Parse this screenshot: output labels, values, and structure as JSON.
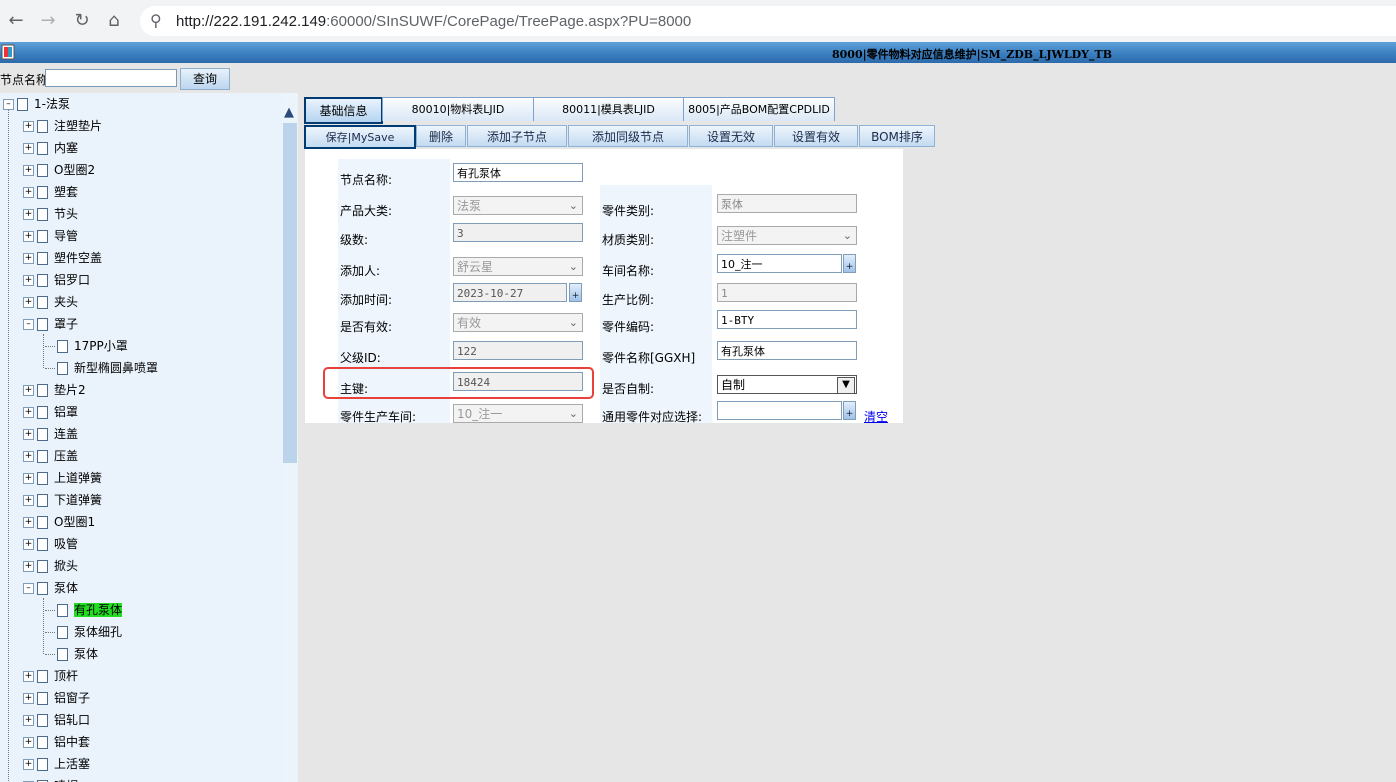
{
  "browser": {
    "url_host": "http://222.191.242.149",
    "url_rest": ":60000/SInSUWF/CorePage/TreePage.aspx?PU=8000"
  },
  "title_bar": {
    "title": "8000|零件物料对应信息维护|SM_ZDB_LJWLDY_TB"
  },
  "search": {
    "label": "节点名称",
    "value": "",
    "button": "查询"
  },
  "tree": {
    "root": "1-法泵",
    "items": [
      "注塑垫片",
      "内塞",
      "O型圈2",
      "塑套",
      "节头",
      "导管",
      "塑件空盖",
      "铝罗口",
      "夹头",
      "罩子",
      "17PP小罩",
      "新型椭圆鼻喷罩",
      "垫片2",
      "铝罩",
      "连盖",
      "压盖",
      "上道弹簧",
      "下道弹簧",
      "O型圈1",
      "吸管",
      "掀头",
      "泵体",
      "有孔泵体",
      "泵体细孔",
      "泵体",
      "顶杆",
      "铝窗子",
      "铝轧口",
      "铝中套",
      "上活塞",
      "喷帽"
    ]
  },
  "tabs": [
    "基础信息",
    "80010|物料表LJID",
    "80011|模具表LJID",
    "8005|产品BOM配置CPDLID"
  ],
  "toolbar": [
    "保存|MySave",
    "删除",
    "添加子节点",
    "添加同级节点",
    "设置无效",
    "设置有效",
    "BOM排序"
  ],
  "form": {
    "node_name_label": "节点名称:",
    "node_name": "有孔泵体",
    "product_category_label": "产品大类:",
    "product_category": "法泵",
    "part_type_label": "零件类别:",
    "part_type": "泵体",
    "level_label": "级数:",
    "level": "3",
    "material_type_label": "材质类别:",
    "material_type": "注塑件",
    "added_by_label": "添加人:",
    "added_by": "舒云星",
    "workshop_label": "车间名称:",
    "workshop": "10_注一",
    "added_time_label": "添加时间:",
    "added_time": "2023-10-27",
    "ratio_label": "生产比例:",
    "ratio": "1",
    "valid_label": "是否有效:",
    "valid": "有效",
    "part_code_label": "零件编码:",
    "part_code": "1-BTY",
    "parent_id_label": "父级ID:",
    "parent_id": "122",
    "part_name_label": "零件名称[GGXH]",
    "part_name": "有孔泵体",
    "primary_key_label": "主键:",
    "primary_key": "18424",
    "self_made_label": "是否自制:",
    "self_made": "自制",
    "prod_workshop_label": "零件生产车间:",
    "prod_workshop": "10_注一",
    "common_part_label": "通用零件对应选择:",
    "common_part": "",
    "clear_link": "清空"
  },
  "colors": {
    "title_bar": "#3b7fc0",
    "selected_node": "#22dd22",
    "highlight_box": "#e8403a"
  }
}
